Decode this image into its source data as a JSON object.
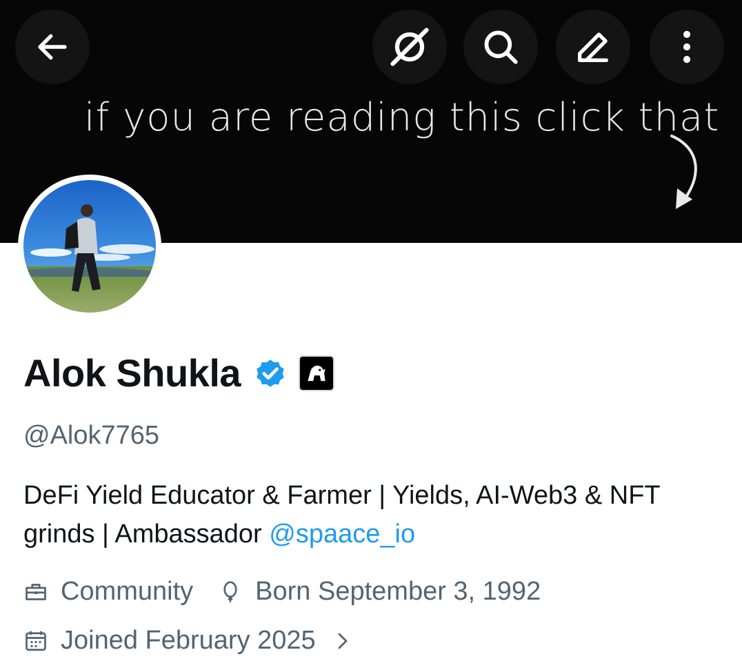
{
  "header": {
    "back_icon": "arrow-left-icon",
    "actions": [
      {
        "icon": "grok-icon"
      },
      {
        "icon": "search-icon"
      },
      {
        "icon": "edit-icon"
      },
      {
        "icon": "more-vertical-icon"
      }
    ]
  },
  "banner": {
    "text": "if you are reading this click that",
    "background": "#060606"
  },
  "profile": {
    "name": "Alok Shukla",
    "handle": "@Alok7765",
    "verified_color": "#1d9bf0",
    "bio_text": "DeFi Yield Educator & Farmer | Yields, AI-Web3 & NFT grinds | Ambassador ",
    "bio_mention": "@spaace_io",
    "category": "Community",
    "birthday": "Born September 3, 1992",
    "joined": "Joined February 2025"
  },
  "colors": {
    "text_primary": "#0f1419",
    "text_secondary": "#536471",
    "link": "#1d9bf0"
  }
}
